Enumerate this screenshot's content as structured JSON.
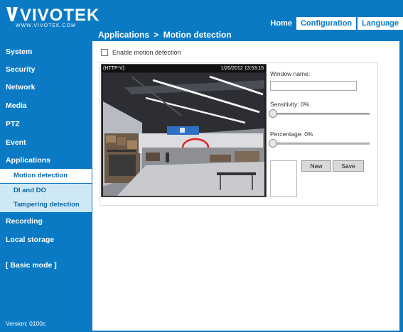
{
  "brand": {
    "name": "VIVOTEK",
    "url": "WWW.VIVOTEK.COM"
  },
  "nav": {
    "tabs": [
      {
        "label": "Home",
        "active": false
      },
      {
        "label": "Configuration",
        "active": true
      },
      {
        "label": "Language",
        "active": false
      }
    ]
  },
  "breadcrumb": {
    "section": "Applications",
    "separator": ">",
    "page": "Motion detection"
  },
  "sidebar": {
    "items": [
      {
        "label": "System"
      },
      {
        "label": "Security"
      },
      {
        "label": "Network"
      },
      {
        "label": "Media"
      },
      {
        "label": "PTZ"
      },
      {
        "label": "Event"
      },
      {
        "label": "Applications"
      }
    ],
    "subitems": [
      {
        "label": "Motion detection",
        "active": true
      },
      {
        "label": "DI and DO",
        "active": false
      },
      {
        "label": "Tampering detection",
        "active": false
      }
    ],
    "after_items": [
      {
        "label": "Recording"
      },
      {
        "label": "Local storage"
      }
    ],
    "mode": "[ Basic mode ]",
    "version": "Version: 0100c"
  },
  "main": {
    "enable_label": "Enable motion detection",
    "enable_checked": false,
    "video": {
      "stream": "(HTTP-V)",
      "timestamp": "1/20/2012 13:53:15"
    },
    "window_name_label": "Window name:",
    "window_name_value": "",
    "sensitivity_label": "Sensitivity: 0%",
    "sensitivity_value": 0,
    "percentage_label": "Percentage: 0%",
    "percentage_value": 0,
    "new_button": "New",
    "save_button": "Save"
  },
  "colors": {
    "brand_blue": "#0a7ac4",
    "submenu_bg": "#cfe8f6"
  }
}
